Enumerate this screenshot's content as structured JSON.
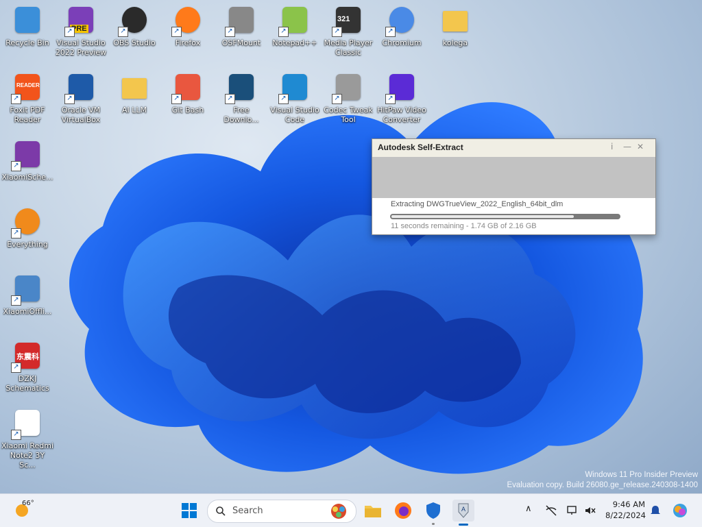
{
  "desktop_icons": [
    {
      "label": "Recycle Bin",
      "icon": "recycle-bin-icon",
      "color": "#3b8fd9"
    },
    {
      "label": "Visual Studio 2022 Preview",
      "icon": "visual-studio-icon",
      "color": "#7b3fb8",
      "badge": "PRE"
    },
    {
      "label": "OBS Studio",
      "icon": "obs-icon",
      "color": "#2a2a2a"
    },
    {
      "label": "Firefox",
      "icon": "firefox-icon",
      "color": "#ff7a1a"
    },
    {
      "label": "OSFMount",
      "icon": "osfmount-icon",
      "color": "#888888"
    },
    {
      "label": "Notepad++",
      "icon": "notepadpp-icon",
      "color": "#8bc34a"
    },
    {
      "label": "Media Player Classic",
      "icon": "media-player-classic-icon",
      "color": "#333333",
      "badge": "321"
    },
    {
      "label": "Chromium",
      "icon": "chromium-icon",
      "color": "#4a8ae6"
    },
    {
      "label": "kolega",
      "icon": "folder-icon",
      "color": "#f3c64d"
    },
    {
      "label": "Foxit PDF Reader",
      "icon": "foxit-icon",
      "color": "#f2541b",
      "badge": "READER"
    },
    {
      "label": "Oracle VM VirtualBox",
      "icon": "virtualbox-icon",
      "color": "#1e5aa8"
    },
    {
      "label": "AI LLM",
      "icon": "folder-icon",
      "color": "#f3c64d"
    },
    {
      "label": "Git Bash",
      "icon": "git-bash-icon",
      "color": "#e9573f"
    },
    {
      "label": "Free Downlo...",
      "icon": "free-download-icon",
      "color": "#1a4f7a"
    },
    {
      "label": "Visual Studio Code",
      "icon": "vscode-icon",
      "color": "#1f8ad2"
    },
    {
      "label": "Codec Tweak Tool",
      "icon": "codec-tweak-icon",
      "color": "#9a9a9a"
    },
    {
      "label": "HitPaw Video Converter",
      "icon": "hitpaw-icon",
      "color": "#5b2bd6"
    },
    {
      "label": "XiaomiSche...",
      "icon": "xiaomi-schematics-icon",
      "color": "#7c3aa8"
    },
    {
      "label": "Everything",
      "icon": "everything-icon",
      "color": "#f08a1c"
    },
    {
      "label": "XiaomiOffli...",
      "icon": "xiaomi-offline-icon",
      "color": "#4a86c8"
    },
    {
      "label": "DZKJ Schematics",
      "icon": "dzkj-icon",
      "color": "#d32a2a",
      "badge": "东震科"
    },
    {
      "label": "Xiaomi Redmi Note2 3Y Sc...",
      "icon": "pdf-document-icon",
      "color": "#ffffff"
    }
  ],
  "watermark": {
    "line1": "Windows 11 Pro Insider Preview",
    "line2": "Evaluation copy. Build 26080.ge_release.240308-1400"
  },
  "dialog": {
    "title": "Autodesk Self-Extract",
    "info_label": "i",
    "minimize_label": "—",
    "close_label": "✕",
    "status": "Extracting DWGTrueView_2022_English_64bit_dlm",
    "remaining": "11 seconds remaining - 1.74 GB of 2.16 GB",
    "progress_fraction": 0.8
  },
  "taskbar": {
    "weather_temp": "66°",
    "search_placeholder": "Search",
    "time": "9:46 AM",
    "date": "8/22/2024",
    "accent": "#0067c0"
  }
}
